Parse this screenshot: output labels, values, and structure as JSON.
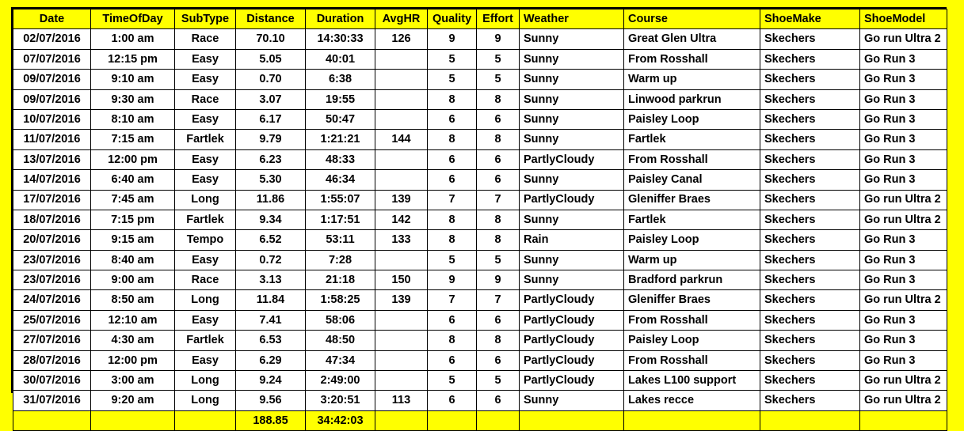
{
  "sheet": {
    "background_color": "#FFFF00",
    "header_background_color": "#FFFF00",
    "cell_background_color": "#FFFFFF",
    "grid_color": "#000000"
  },
  "table": {
    "columns": [
      "Date",
      "TimeOfDay",
      "SubType",
      "Distance",
      "Duration",
      "AvgHR",
      "Quality",
      "Effort",
      "Weather",
      "Course",
      "ShoeMake",
      "ShoeModel"
    ],
    "rows": [
      {
        "date": "02/07/2016",
        "time_of_day": "1:00 am",
        "sub_type": "Race",
        "distance": "70.10",
        "duration": "14:30:33",
        "avg_hr": "126",
        "quality": "9",
        "effort": "9",
        "weather": "Sunny",
        "course": "Great Glen Ultra",
        "shoe_make": "Skechers",
        "shoe_model": "Go run Ultra 2"
      },
      {
        "date": "07/07/2016",
        "time_of_day": "12:15 pm",
        "sub_type": "Easy",
        "distance": "5.05",
        "duration": "40:01",
        "avg_hr": "",
        "quality": "5",
        "effort": "5",
        "weather": "Sunny",
        "course": "From Rosshall",
        "shoe_make": "Skechers",
        "shoe_model": "Go Run 3"
      },
      {
        "date": "09/07/2016",
        "time_of_day": "9:10 am",
        "sub_type": "Easy",
        "distance": "0.70",
        "duration": "6:38",
        "avg_hr": "",
        "quality": "5",
        "effort": "5",
        "weather": "Sunny",
        "course": "Warm up",
        "shoe_make": "Skechers",
        "shoe_model": "Go Run 3"
      },
      {
        "date": "09/07/2016",
        "time_of_day": "9:30 am",
        "sub_type": "Race",
        "distance": "3.07",
        "duration": "19:55",
        "avg_hr": "",
        "quality": "8",
        "effort": "8",
        "weather": "Sunny",
        "course": "Linwood parkrun",
        "shoe_make": "Skechers",
        "shoe_model": "Go Run 3"
      },
      {
        "date": "10/07/2016",
        "time_of_day": "8:10 am",
        "sub_type": "Easy",
        "distance": "6.17",
        "duration": "50:47",
        "avg_hr": "",
        "quality": "6",
        "effort": "6",
        "weather": "Sunny",
        "course": "Paisley Loop",
        "shoe_make": "Skechers",
        "shoe_model": "Go Run 3"
      },
      {
        "date": "11/07/2016",
        "time_of_day": "7:15 am",
        "sub_type": "Fartlek",
        "distance": "9.79",
        "duration": "1:21:21",
        "avg_hr": "144",
        "quality": "8",
        "effort": "8",
        "weather": "Sunny",
        "course": "Fartlek",
        "shoe_make": "Skechers",
        "shoe_model": "Go Run 3"
      },
      {
        "date": "13/07/2016",
        "time_of_day": "12:00 pm",
        "sub_type": "Easy",
        "distance": "6.23",
        "duration": "48:33",
        "avg_hr": "",
        "quality": "6",
        "effort": "6",
        "weather": "PartlyCloudy",
        "course": "From Rosshall",
        "shoe_make": "Skechers",
        "shoe_model": "Go Run 3"
      },
      {
        "date": "14/07/2016",
        "time_of_day": "6:40 am",
        "sub_type": "Easy",
        "distance": "5.30",
        "duration": "46:34",
        "avg_hr": "",
        "quality": "6",
        "effort": "6",
        "weather": "Sunny",
        "course": "Paisley Canal",
        "shoe_make": "Skechers",
        "shoe_model": "Go Run 3"
      },
      {
        "date": "17/07/2016",
        "time_of_day": "7:45 am",
        "sub_type": "Long",
        "distance": "11.86",
        "duration": "1:55:07",
        "avg_hr": "139",
        "quality": "7",
        "effort": "7",
        "weather": "PartlyCloudy",
        "course": "Gleniffer Braes",
        "shoe_make": "Skechers",
        "shoe_model": "Go run Ultra 2"
      },
      {
        "date": "18/07/2016",
        "time_of_day": "7:15 pm",
        "sub_type": "Fartlek",
        "distance": "9.34",
        "duration": "1:17:51",
        "avg_hr": "142",
        "quality": "8",
        "effort": "8",
        "weather": "Sunny",
        "course": "Fartlek",
        "shoe_make": "Skechers",
        "shoe_model": "Go run Ultra 2"
      },
      {
        "date": "20/07/2016",
        "time_of_day": "9:15 am",
        "sub_type": "Tempo",
        "distance": "6.52",
        "duration": "53:11",
        "avg_hr": "133",
        "quality": "8",
        "effort": "8",
        "weather": "Rain",
        "course": "Paisley Loop",
        "shoe_make": "Skechers",
        "shoe_model": "Go Run 3"
      },
      {
        "date": "23/07/2016",
        "time_of_day": "8:40 am",
        "sub_type": "Easy",
        "distance": "0.72",
        "duration": "7:28",
        "avg_hr": "",
        "quality": "5",
        "effort": "5",
        "weather": "Sunny",
        "course": "Warm up",
        "shoe_make": "Skechers",
        "shoe_model": "Go Run 3"
      },
      {
        "date": "23/07/2016",
        "time_of_day": "9:00 am",
        "sub_type": "Race",
        "distance": "3.13",
        "duration": "21:18",
        "avg_hr": "150",
        "quality": "9",
        "effort": "9",
        "weather": "Sunny",
        "course": "Bradford parkrun",
        "shoe_make": "Skechers",
        "shoe_model": "Go Run 3"
      },
      {
        "date": "24/07/2016",
        "time_of_day": "8:50 am",
        "sub_type": "Long",
        "distance": "11.84",
        "duration": "1:58:25",
        "avg_hr": "139",
        "quality": "7",
        "effort": "7",
        "weather": "PartlyCloudy",
        "course": "Gleniffer Braes",
        "shoe_make": "Skechers",
        "shoe_model": "Go run Ultra 2"
      },
      {
        "date": "25/07/2016",
        "time_of_day": "12:10 am",
        "sub_type": "Easy",
        "distance": "7.41",
        "duration": "58:06",
        "avg_hr": "",
        "quality": "6",
        "effort": "6",
        "weather": "PartlyCloudy",
        "course": "From Rosshall",
        "shoe_make": "Skechers",
        "shoe_model": "Go Run 3"
      },
      {
        "date": "27/07/2016",
        "time_of_day": "4:30 am",
        "sub_type": "Fartlek",
        "distance": "6.53",
        "duration": "48:50",
        "avg_hr": "",
        "quality": "8",
        "effort": "8",
        "weather": "PartlyCloudy",
        "course": "Paisley Loop",
        "shoe_make": "Skechers",
        "shoe_model": "Go Run 3"
      },
      {
        "date": "28/07/2016",
        "time_of_day": "12:00 pm",
        "sub_type": "Easy",
        "distance": "6.29",
        "duration": "47:34",
        "avg_hr": "",
        "quality": "6",
        "effort": "6",
        "weather": "PartlyCloudy",
        "course": "From Rosshall",
        "shoe_make": "Skechers",
        "shoe_model": "Go Run 3"
      },
      {
        "date": "30/07/2016",
        "time_of_day": "3:00 am",
        "sub_type": "Long",
        "distance": "9.24",
        "duration": "2:49:00",
        "avg_hr": "",
        "quality": "5",
        "effort": "5",
        "weather": "PartlyCloudy",
        "course": "Lakes L100 support",
        "shoe_make": "Skechers",
        "shoe_model": "Go run Ultra 2"
      },
      {
        "date": "31/07/2016",
        "time_of_day": "9:20 am",
        "sub_type": "Long",
        "distance": "9.56",
        "duration": "3:20:51",
        "avg_hr": "113",
        "quality": "6",
        "effort": "6",
        "weather": "Sunny",
        "course": "Lakes recce",
        "shoe_make": "Skechers",
        "shoe_model": "Go run Ultra 2"
      }
    ],
    "total_row": {
      "date": "",
      "time_of_day": "",
      "sub_type": "",
      "distance": "188.85",
      "duration": "34:42:03",
      "avg_hr": "",
      "quality": "",
      "effort": "",
      "weather": "",
      "course": "",
      "shoe_make": "",
      "shoe_model": ""
    }
  }
}
